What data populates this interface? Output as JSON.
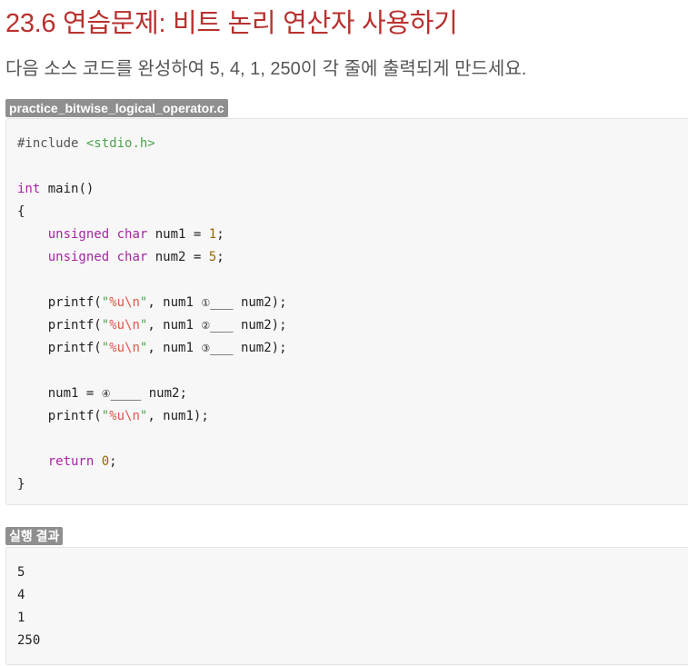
{
  "title": "23.6 연습문제: 비트 논리 연산자 사용하기",
  "description": "다음 소스 코드를 완성하여 5, 4, 1, 250이 각 줄에 출력되게 만드세요.",
  "file_tag": "practice_bitwise_logical_operator.c",
  "code": {
    "include_directive": "#include",
    "include_header": "<stdio.h>",
    "int_kw": "int",
    "main_sig": "main()",
    "open_brace": "{",
    "unsigned_kw": "unsigned",
    "char_kw": "char",
    "num1_decl": "num1 = ",
    "num1_val": "1",
    "num2_decl": "num2 = ",
    "num2_val": "5",
    "semicolon": ";",
    "printf": "printf(",
    "quote": "\"",
    "fmt": "%u",
    "newline_esc": "\\n",
    "args_prefix": ", num1 ",
    "blank1_mark": "①",
    "blank2_mark": "②",
    "blank3_mark": "③",
    "blank4_mark": "④",
    "blank_short": "___",
    "blank_long": "____",
    "args_suffix": " num2);",
    "assign_prefix": "num1 = ",
    "assign_suffix": " num2;",
    "last_args": ", num1);",
    "return_kw": "return",
    "return_val": "0",
    "close_brace": "}"
  },
  "result_tag": "실행 결과",
  "output_lines": [
    "5",
    "4",
    "1",
    "250"
  ]
}
